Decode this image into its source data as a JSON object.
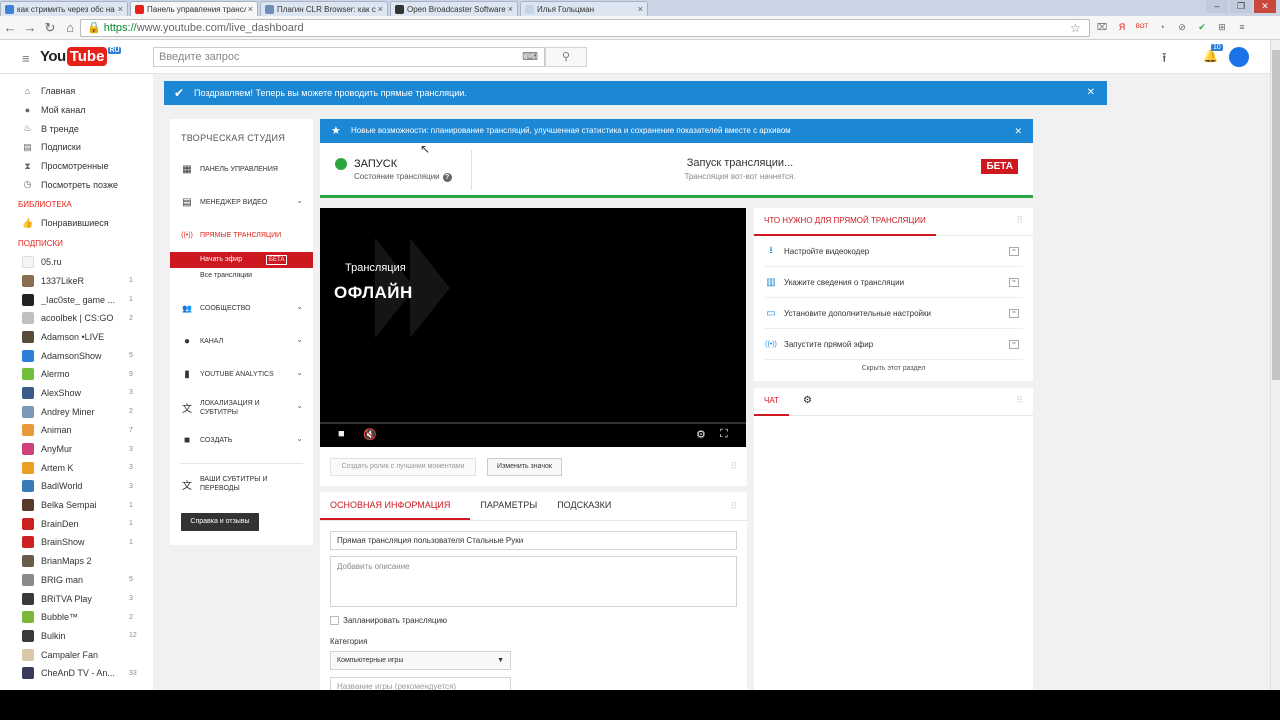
{
  "browser": {
    "tabs": [
      {
        "label": "как стримить через обс на",
        "color": "#3b82d6"
      },
      {
        "label": "Панель управления трансл",
        "color": "#e62117"
      },
      {
        "label": "Плагин CLR Browser: как с",
        "color": "#6b8fb8"
      },
      {
        "label": "Open Broadcaster Software",
        "color": "#333333"
      },
      {
        "label": "Илья Гольцман",
        "color": "#c6d4e6"
      }
    ],
    "url_https": "https://",
    "url_rest": "www.youtube.com/live_dashboard",
    "window_controls": [
      "‒",
      "❐",
      "✕"
    ],
    "ext_icons": [
      "⌧",
      "Я",
      "ВОТ",
      "◔",
      "⊘",
      "✔",
      "⊞",
      "≡"
    ]
  },
  "header": {
    "logo_you": "You",
    "logo_tube": "Tube",
    "logo_region": "RU",
    "search_placeholder": "Введите запрос",
    "notif_count": "10"
  },
  "sidebar": {
    "nav": [
      {
        "label": "Главная",
        "icon": "⌂"
      },
      {
        "label": "Мой канал",
        "icon": "●"
      },
      {
        "label": "В тренде",
        "icon": "♨"
      },
      {
        "label": "Подписки",
        "icon": "▤"
      },
      {
        "label": "Просмотренные",
        "icon": "⧗"
      },
      {
        "label": "Посмотреть позже",
        "icon": "◷"
      }
    ],
    "library_title": "БИБЛИОТЕКА",
    "liked": "Понравившиеся",
    "subs_title": "ПОДПИСКИ",
    "subscriptions": [
      {
        "name": "05.ru",
        "count": "",
        "color": "#f5f5f5"
      },
      {
        "name": "1337LikeR",
        "count": "1",
        "color": "#8a6e4e"
      },
      {
        "name": "_Iac0ste_ game ...",
        "count": "1",
        "color": "#222222"
      },
      {
        "name": "acoolbek | CS:GO",
        "count": "2",
        "color": "#bfbfbf"
      },
      {
        "name": "Adamson •LIVE",
        "count": "",
        "color": "#5a4a3a"
      },
      {
        "name": "AdamsonShow",
        "count": "5",
        "color": "#2b7fd6"
      },
      {
        "name": "Alermo",
        "count": "9",
        "color": "#6fbf3a"
      },
      {
        "name": "AlexShow",
        "count": "3",
        "color": "#3a5a8a"
      },
      {
        "name": "Andrey Miner",
        "count": "2",
        "color": "#7a9ab8"
      },
      {
        "name": "Animan",
        "count": "7",
        "color": "#e89a3a"
      },
      {
        "name": "AnyMur",
        "count": "3",
        "color": "#d0407a"
      },
      {
        "name": "Artem K",
        "count": "3",
        "color": "#e8a020"
      },
      {
        "name": "BadiWorld",
        "count": "3",
        "color": "#3a7ab8"
      },
      {
        "name": "Belka Sempai",
        "count": "1",
        "color": "#5a3a2a"
      },
      {
        "name": "BrainDen",
        "count": "1",
        "color": "#cc2222"
      },
      {
        "name": "BrainShow",
        "count": "1",
        "color": "#cc2222"
      },
      {
        "name": "BrianMaps 2",
        "count": "",
        "color": "#6a5a4a"
      },
      {
        "name": "BRIG man",
        "count": "5",
        "color": "#8a8a8a"
      },
      {
        "name": "BRiTVA Play",
        "count": "3",
        "color": "#3a3a3a"
      },
      {
        "name": "Bubble™",
        "count": "2",
        "color": "#7ab83a"
      },
      {
        "name": "Bulkin",
        "count": "12",
        "color": "#3a3a3a"
      },
      {
        "name": "Campaler Fan",
        "count": "",
        "color": "#d8c8a8"
      },
      {
        "name": "CheAnD TV - An...",
        "count": "33",
        "color": "#3a3a5a"
      }
    ]
  },
  "notice": "Поздравляем! Теперь вы можете проводить прямые трансляции.",
  "studio": {
    "title": "ТВОРЧЕСКАЯ СТУДИЯ",
    "items": [
      {
        "label": "Панель управления",
        "icon": "▦"
      },
      {
        "label": "Менеджер видео",
        "icon": "▤"
      },
      {
        "label": "Прямые трансляции",
        "icon": "((•))"
      },
      {
        "label": "Сообщество",
        "icon": "👥"
      },
      {
        "label": "Канал",
        "icon": "●"
      },
      {
        "label": "YouTube Analytics",
        "icon": "▮"
      },
      {
        "label": "Локализация и субтитры",
        "icon": "文"
      },
      {
        "label": "Создать",
        "icon": "■"
      },
      {
        "label": "Ваши субтитры и переводы",
        "icon": "文"
      }
    ],
    "sub_start": "Начать эфир",
    "sub_beta": "БЕТА",
    "sub_all": "Все трансляции",
    "help": "Справка и отзывы"
  },
  "feature_bar": "Новые возможности: планирование трансляций, улучшенная статистика и сохранение показателей вместе с архивом",
  "status": {
    "label": "ЗАПУСК",
    "sublabel": "Состояние трансляции",
    "launch": "Запуск трансляции...",
    "launch_sub": "Трансляция вот-вот начнется.",
    "beta": "БЕТА",
    "color": "#2ba640"
  },
  "player": {
    "label": "Трансляция",
    "state": "ОФЛАЙН"
  },
  "below_player": {
    "create_clip": "Создать ролик с лучшими моментами",
    "change_icon": "Изменить значок"
  },
  "info": {
    "tabs": [
      "Основная информация",
      "Параметры",
      "Подсказки"
    ],
    "title_value": "Прямая трансляция пользователя Стальные Руки",
    "desc_placeholder": "Добавить описание",
    "schedule": "Запланировать трансляцию",
    "category_label": "Категория",
    "category_value": "Компьютерные игры",
    "game_placeholder": "Название игры (рекомендуется)"
  },
  "needs": {
    "title": "ЧТО НУЖНО ДЛЯ ПРЯМОЙ ТРАНСЛЯЦИИ",
    "items": [
      {
        "label": "Настройте видеокодер",
        "icon": "⭳"
      },
      {
        "label": "Укажите сведения о трансляции",
        "icon": "▥"
      },
      {
        "label": "Установите дополнительные настройки",
        "icon": "▭"
      },
      {
        "label": "Запустите прямой эфир",
        "icon": "((•))"
      }
    ],
    "hide": "Скрыть этот раздел"
  },
  "chat": {
    "title": "ЧАТ"
  }
}
